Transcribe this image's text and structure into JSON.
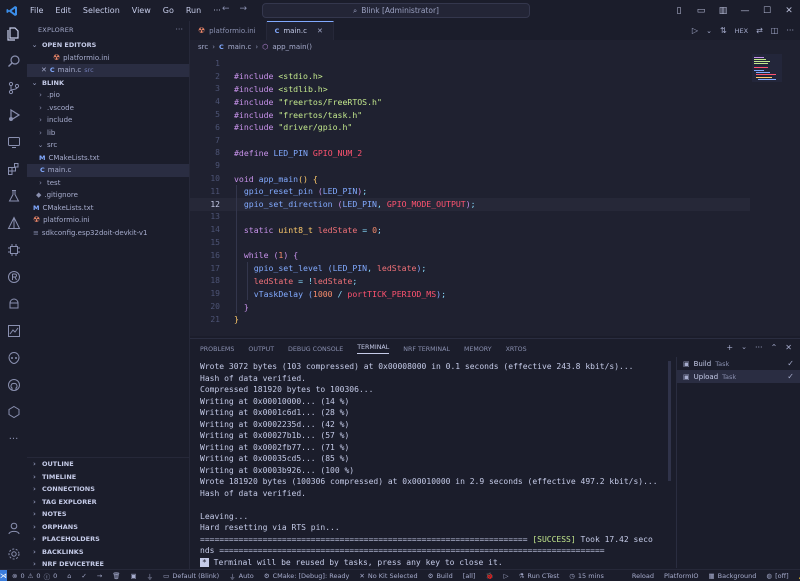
{
  "titlebar": {
    "menu": [
      "File",
      "Edit",
      "Selection",
      "View",
      "Go",
      "Run"
    ],
    "search_text": "Blink [Administrator]"
  },
  "sidebar": {
    "title": "EXPLORER",
    "open_editors_label": "OPEN EDITORS",
    "open_editors": [
      {
        "name": "platformio.ini",
        "icon": "platformio-icon",
        "tag": ""
      },
      {
        "name": "main.c",
        "icon": "c-file-icon",
        "tag": "src"
      }
    ],
    "project_label": "BLINK",
    "tree": [
      {
        "name": ".pio",
        "kind": "folder",
        "open": false,
        "depth": 1
      },
      {
        "name": ".vscode",
        "kind": "folder",
        "open": false,
        "depth": 1
      },
      {
        "name": "include",
        "kind": "folder",
        "open": false,
        "depth": 1
      },
      {
        "name": "lib",
        "kind": "folder",
        "open": false,
        "depth": 1
      },
      {
        "name": "src",
        "kind": "folder",
        "open": true,
        "depth": 1
      },
      {
        "name": "CMakeLists.txt",
        "kind": "cmake",
        "depth": 2
      },
      {
        "name": "main.c",
        "kind": "c",
        "depth": 2,
        "selected": true
      },
      {
        "name": "test",
        "kind": "folder",
        "open": false,
        "depth": 1
      },
      {
        "name": ".gitignore",
        "kind": "git",
        "depth": 1
      },
      {
        "name": "CMakeLists.txt",
        "kind": "cmake",
        "depth": 1
      },
      {
        "name": "platformio.ini",
        "kind": "pio",
        "depth": 1
      },
      {
        "name": "sdkconfig.esp32doit-devkit-v1",
        "kind": "file",
        "depth": 1
      }
    ],
    "collapsed_sections": [
      "OUTLINE",
      "TIMELINE",
      "CONNECTIONS",
      "TAG EXPLORER",
      "NOTES",
      "ORPHANS",
      "PLACEHOLDERS",
      "BACKLINKS",
      "NRF DEVICETREE"
    ]
  },
  "tabs": [
    {
      "label": "platformio.ini",
      "active": false
    },
    {
      "label": "main.c",
      "active": true
    }
  ],
  "editor_actions": {
    "hex_label": "HEX"
  },
  "breadcrumb": {
    "folder": "src",
    "file": "main.c",
    "symbol": "app_main()"
  },
  "editor": {
    "current_line": 12,
    "lines": [
      {
        "n": 1,
        "html": ""
      },
      {
        "n": 2,
        "html": "<span class=\"kw\">#include</span> <span class=\"str\">&lt;stdio.h&gt;</span>"
      },
      {
        "n": 3,
        "html": "<span class=\"kw\">#include</span> <span class=\"str\">&lt;stdlib.h&gt;</span>"
      },
      {
        "n": 4,
        "html": "<span class=\"kw\">#include</span> <span class=\"str\">\"freertos/FreeRTOS.h\"</span>"
      },
      {
        "n": 5,
        "html": "<span class=\"kw\">#include</span> <span class=\"str\">\"freertos/task.h\"</span>"
      },
      {
        "n": 6,
        "html": "<span class=\"kw\">#include</span> <span class=\"str\">\"driver/gpio.h\"</span>"
      },
      {
        "n": 7,
        "html": ""
      },
      {
        "n": 8,
        "html": "<span class=\"kw\">#define</span> <span class=\"fn\">LED_PIN</span> <span class=\"mac\">GPIO_NUM_2</span>"
      },
      {
        "n": 9,
        "html": ""
      },
      {
        "n": 10,
        "html": "<span class=\"kw\">void</span> <span class=\"fn\">app_main</span><span class=\"ty\">()</span> <span class=\"ty\">{</span>"
      },
      {
        "n": 11,
        "html": "  <span class=\"fn\">gpio_reset_pin</span> <span class=\"kw\">(</span><span class=\"fn\">LED_PIN</span><span class=\"kw\">)</span><span class=\"pu\">;</span>"
      },
      {
        "n": 12,
        "html": "  <span class=\"fn\">gpio_set_direction</span> <span class=\"kw\">(</span><span class=\"fn\">LED_PIN</span><span class=\"pu\">,</span> <span class=\"mac\">GPIO_MODE_OUTPUT</span><span class=\"kw\">)</span><span class=\"pu\">;</span>"
      },
      {
        "n": 13,
        "html": ""
      },
      {
        "n": 14,
        "html": "  <span class=\"kw\">static</span> <span class=\"ty\">uint8_t</span> <span class=\"var\">ledState</span> <span class=\"op\">=</span> <span class=\"num\">0</span><span class=\"pu\">;</span>"
      },
      {
        "n": 15,
        "html": ""
      },
      {
        "n": 16,
        "html": "  <span class=\"kw\">while</span> <span class=\"kw\">(</span><span class=\"num\">1</span><span class=\"kw\">)</span> <span class=\"kw\">{</span>"
      },
      {
        "n": 17,
        "html": "    <span class=\"fn\">gpio_set_level</span> <span class=\"fn\">(</span><span class=\"fn\">LED_PIN</span><span class=\"pu\">,</span> <span class=\"var\">ledState</span><span class=\"fn\">)</span><span class=\"pu\">;</span>"
      },
      {
        "n": 18,
        "html": "    <span class=\"var\">ledState</span> <span class=\"op\">=</span> <span class=\"op\">!</span><span class=\"var\">ledState</span><span class=\"pu\">;</span>"
      },
      {
        "n": 19,
        "html": "    <span class=\"fn\">vTaskDelay</span> <span class=\"fn\">(</span><span class=\"num\">1000</span> <span class=\"op\">/</span> <span class=\"mac\">portTICK_PERIOD_MS</span><span class=\"fn\">)</span><span class=\"pu\">;</span>"
      },
      {
        "n": 20,
        "html": "  <span class=\"kw\">}</span>"
      },
      {
        "n": 21,
        "html": "<span class=\"ty\">}</span>"
      }
    ]
  },
  "panel": {
    "tabs": [
      "PROBLEMS",
      "OUTPUT",
      "DEBUG CONSOLE",
      "TERMINAL",
      "NRF TERMINAL",
      "MEMORY",
      "XRTOS"
    ],
    "active_tab": "TERMINAL",
    "terminal_lines": [
      "Wrote 3072 bytes (103 compressed) at 0x00008000 in 0.1 seconds (effective 243.8 kbit/s)...",
      "Hash of data verified.",
      "Compressed 181920 bytes to 100306...",
      "Writing at 0x00010000... (14 %)",
      "Writing at 0x0001c6d1... (28 %)",
      "Writing at 0x0002235d... (42 %)",
      "Writing at 0x00027b1b... (57 %)",
      "Writing at 0x0002fb77... (71 %)",
      "Writing at 0x00035cd5... (85 %)",
      "Writing at 0x0003b926... (100 %)",
      "Wrote 181920 bytes (100306 compressed) at 0x00010000 in 2.9 seconds (effective 497.2 kbit/s)...",
      "Hash of data verified.",
      "",
      "Leaving...",
      "Hard resetting via RTS pin..."
    ],
    "success_line_prefix": "==================================================================== ",
    "success_tag": "[SUCCESS]",
    "success_line_suffix": " Took 17.42 seco",
    "success_line2": "nds ================================================================================",
    "reuse_notice": "Terminal will be reused by tasks, press any key to close it.",
    "tasks": [
      {
        "label": "Build",
        "type": "Task"
      },
      {
        "label": "Upload",
        "type": "Task"
      }
    ]
  },
  "statusbar": {
    "errors": "0",
    "warnings": "0",
    "info": "0",
    "env": "Default (Blink)",
    "auto": "Auto",
    "cmake": "CMake: [Debug]: Ready",
    "kit": "No Kit Selected",
    "build": "Build",
    "all": "[all]",
    "run_ctest": "Run CTest",
    "timer": "15 mins",
    "reload": "Reload",
    "platformio": "PlatformIO",
    "background": "Background",
    "off": "[off]"
  }
}
